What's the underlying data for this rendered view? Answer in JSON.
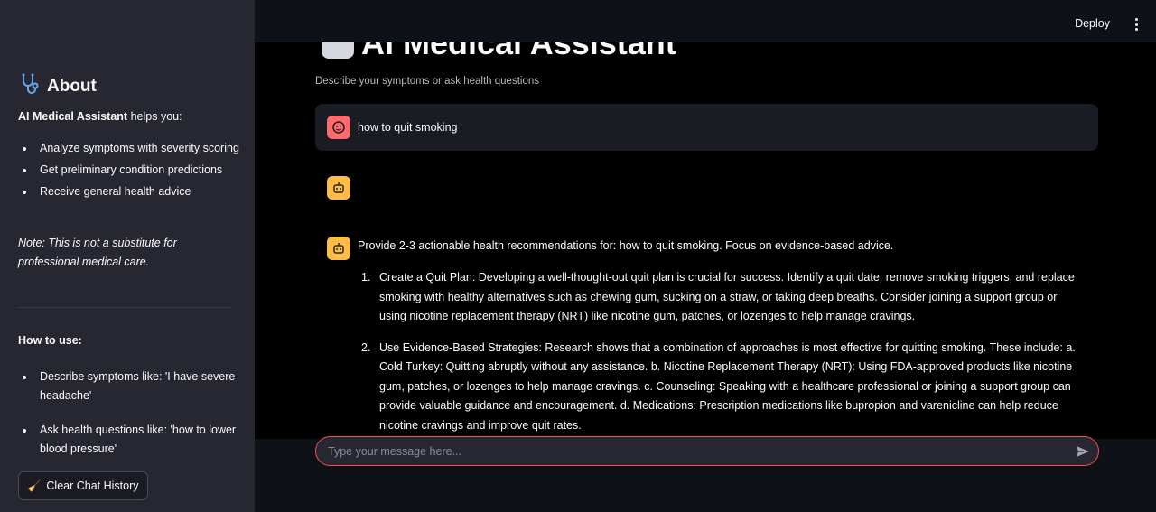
{
  "header": {
    "deploy_label": "Deploy"
  },
  "sidebar": {
    "title": "About",
    "intro_bold": "AI Medical Assistant",
    "intro_rest": " helps you:",
    "features": [
      "Analyze symptoms with severity scoring",
      "Get preliminary condition predictions",
      "Receive general health advice"
    ],
    "note": "Note: This is not a substitute for professional medical care.",
    "howto_title": "How to use:",
    "howto_items": [
      "Describe symptoms like: 'I have severe headache'",
      "Ask health questions like: 'how to lower blood pressure'"
    ],
    "clear_button": "Clear Chat History"
  },
  "main": {
    "title": "AI Medical Assistant",
    "subtitle": "Describe your symptoms or ask health questions",
    "user_message": "how to quit smoking",
    "bot_heading": "Provide 2-3 actionable health recommendations for: how to quit smoking. Focus on evidence-based advice.",
    "recommendations": [
      {
        "num": "1.",
        "text": "Create a Quit Plan: Developing a well-thought-out quit plan is crucial for success. Identify a quit date, remove smoking triggers, and replace smoking with healthy alternatives such as chewing gum, sucking on a straw, or taking deep breaths. Consider joining a support group or using nicotine replacement therapy (NRT) like nicotine gum, patches, or lozenges to help manage cravings."
      },
      {
        "num": "2.",
        "text": "Use Evidence-Based Strategies: Research shows that a combination of approaches is most effective for quitting smoking. These include: a. Cold Turkey: Quitting abruptly without any assistance. b. Nicotine Replacement Therapy (NRT): Using FDA-approved products like nicotine gum, patches, or lozenges to help manage cravings. c. Counseling: Speaking with a healthcare professional or joining a support group can provide valuable guidance and encouragement. d. Medications: Prescription medications like bupropion and varenicline can help reduce nicotine cravings and improve quit rates."
      }
    ]
  },
  "chat_input": {
    "placeholder": "Type your message here..."
  },
  "colors": {
    "sidebar_bg": "#262730",
    "main_bg": "#000000",
    "user_avatar": "#ff6b6b",
    "bot_avatar": "#ffbd45",
    "input_border": "#ff4b4b"
  },
  "icons": {
    "about": "stethoscope-icon",
    "clear": "broom-icon",
    "user_avatar": "user-face-icon",
    "bot_avatar": "robot-icon",
    "send": "send-icon",
    "menu": "kebab-menu-icon"
  }
}
